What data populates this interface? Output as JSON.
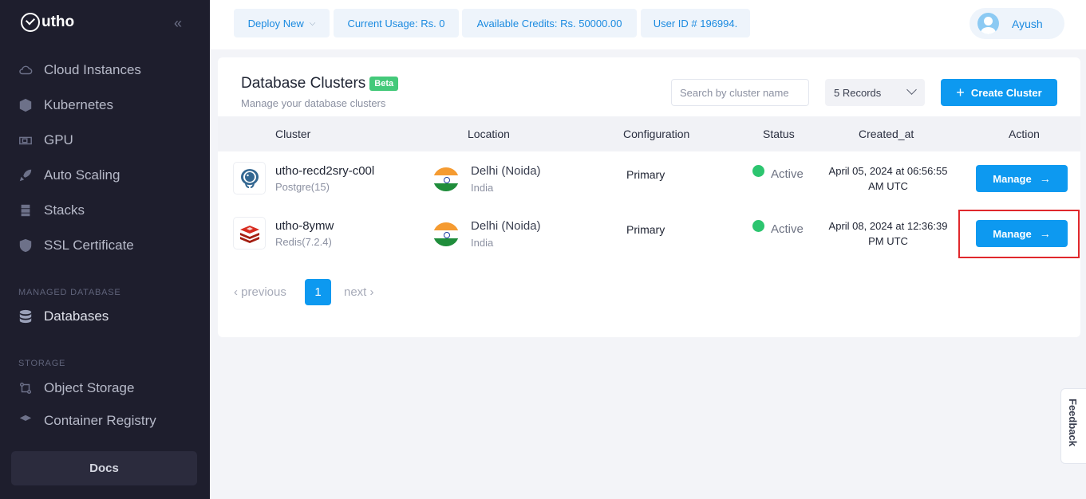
{
  "brand": {
    "name": "utho"
  },
  "sidebar": {
    "items": [
      {
        "label": "Cloud Instances",
        "icon": "cloud-icon"
      },
      {
        "label": "Kubernetes",
        "icon": "kubernetes-icon"
      },
      {
        "label": "GPU",
        "icon": "gpu-icon"
      },
      {
        "label": "Auto Scaling",
        "icon": "rocket-icon"
      },
      {
        "label": "Stacks",
        "icon": "stacks-icon"
      },
      {
        "label": "SSL Certificate",
        "icon": "shield-icon"
      }
    ],
    "managed_database_label": "MANAGED DATABASE",
    "databases_label": "Databases",
    "storage_label": "STORAGE",
    "object_storage_label": "Object Storage",
    "container_registry_label": "Container Registry",
    "docs_label": "Docs"
  },
  "topbar": {
    "deploy_new": "Deploy New",
    "current_usage": "Current Usage: Rs. 0",
    "available_credits": "Available Credits: Rs. 50000.00",
    "user_id": "User ID # 196994.",
    "user_name": "Ayush"
  },
  "page": {
    "title": "Database Clusters",
    "badge": "Beta",
    "subtitle": "Manage your database clusters",
    "search_placeholder": "Search by cluster name",
    "records": "5 Records",
    "create_button": "Create Cluster"
  },
  "table": {
    "headers": [
      "Cluster",
      "Location",
      "Configuration",
      "Status",
      "Created_at",
      "Action"
    ],
    "rows": [
      {
        "name": "utho-recd2sry-c00l",
        "engine": "Postgre(15)",
        "engine_icon": "postgres-icon",
        "location": "Delhi (Noida)",
        "country": "India",
        "configuration": "Primary",
        "status": "Active",
        "created_line1": "April 05, 2024 at 06:56:55",
        "created_line2": "AM UTC",
        "action": "Manage"
      },
      {
        "name": "utho-8ymw",
        "engine": "Redis(7.2.4)",
        "engine_icon": "redis-icon",
        "location": "Delhi (Noida)",
        "country": "India",
        "configuration": "Primary",
        "status": "Active",
        "created_line1": "April 08, 2024 at 12:36:39",
        "created_line2": "PM UTC",
        "action": "Manage"
      }
    ]
  },
  "pagination": {
    "previous": "‹ previous",
    "current": "1",
    "next": "next ›"
  },
  "feedback": "Feedback",
  "colors": {
    "accent": "#0d99f0",
    "sidebar_bg": "#1e1e2d",
    "active_status": "#2cc56f",
    "highlight": "#e0282c",
    "beta": "#44c97a"
  }
}
